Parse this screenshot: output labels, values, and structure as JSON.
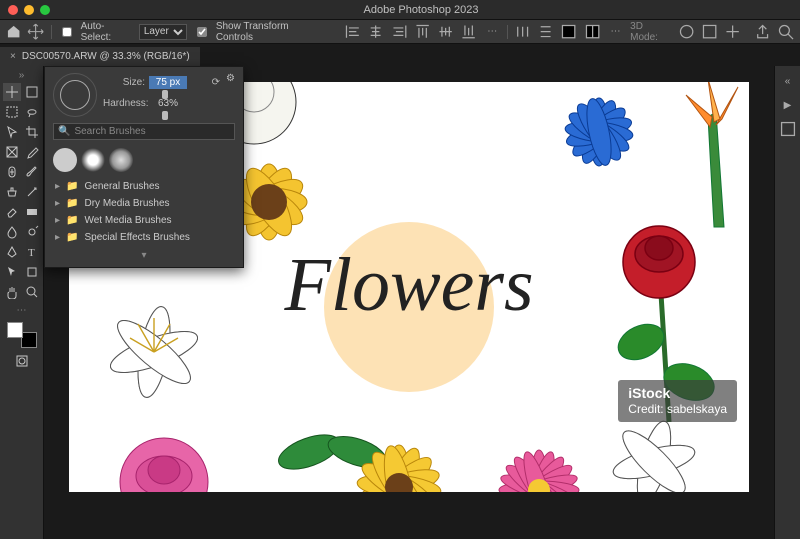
{
  "window": {
    "title": "Adobe Photoshop 2023"
  },
  "optionsbar": {
    "auto_select_label": "Auto-Select:",
    "auto_select_value": "Layer",
    "show_transform_label": "Show Transform Controls",
    "threeD": "3D Mode:"
  },
  "tab": {
    "label": "DSC00570.ARW @ 33.3% (RGB/16*)",
    "close": "×"
  },
  "brushpanel": {
    "size_label": "Size:",
    "size_value": "75 px",
    "hardness_label": "Hardness:",
    "hardness_value": "63%",
    "search_placeholder": "Search Brushes",
    "folders": [
      "General Brushes",
      "Dry Media Brushes",
      "Wet Media Brushes",
      "Special Effects Brushes"
    ]
  },
  "canvas": {
    "headline": "Flowers",
    "watermark_brand": "iStock",
    "watermark_credit": "Credit: sabelskaya"
  }
}
